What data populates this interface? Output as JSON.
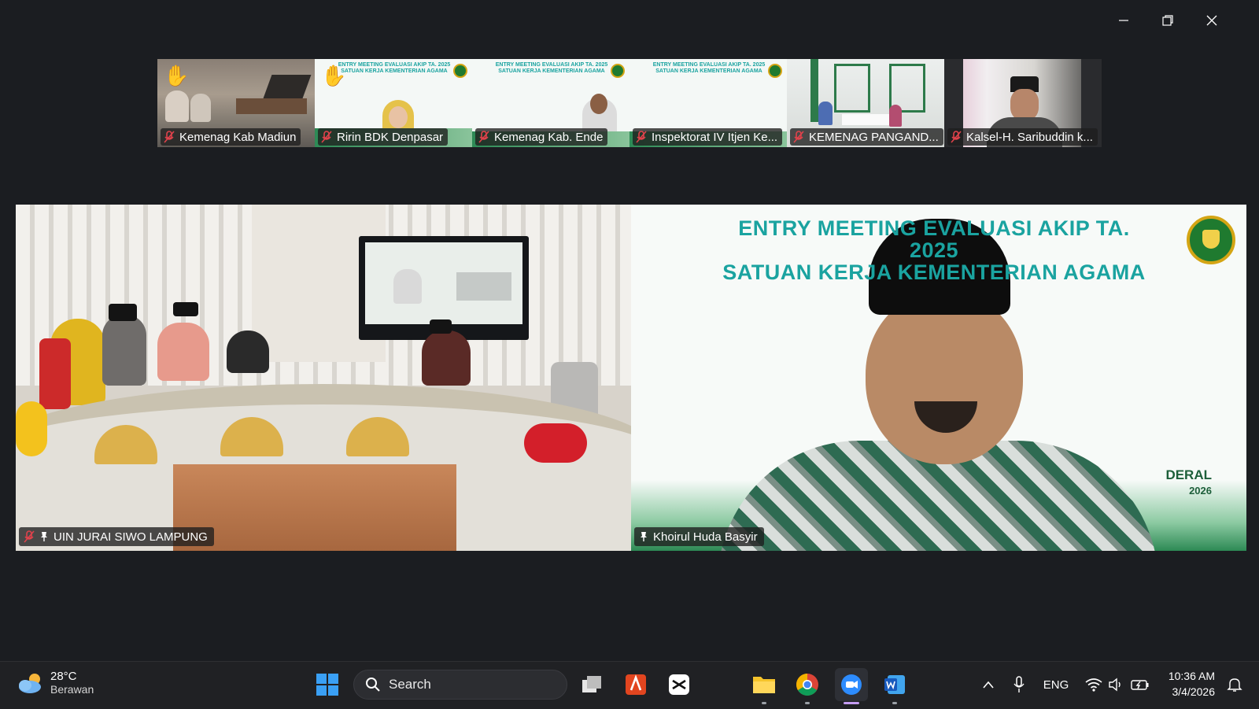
{
  "thumbnails": [
    {
      "name": "Kemenag Kab Madiun",
      "hand_raised": true,
      "banner": ""
    },
    {
      "name": "Ririn BDK Denpasar",
      "hand_raised": true,
      "banner": "ENTRY MEETING EVALUASI AKIP TA. 2025 SATUAN KERJA KEMENTERIAN AGAMA"
    },
    {
      "name": "Kemenag Kab. Ende",
      "hand_raised": false,
      "banner": "ENTRY MEETING EVALUASI AKIP TA. 2025 SATUAN KERJA KEMENTERIAN AGAMA"
    },
    {
      "name": "Inspektorat IV Itjen Ke...",
      "hand_raised": false,
      "banner": "ENTRY MEETING EVALUASI AKIP TA. 2025 SATUAN KERJA KEMENTERIAN AGAMA"
    },
    {
      "name": "KEMENAG PANGAND...",
      "hand_raised": false,
      "banner": ""
    },
    {
      "name": "Kalsel-H. Saribuddin k...",
      "hand_raised": false,
      "banner": ""
    }
  ],
  "main": {
    "left": {
      "name": "UIN JURAI SIWO LAMPUNG"
    },
    "right": {
      "name": "Khoirul Huda Basyir",
      "banner_line1": "ENTRY MEETING EVALUASI AKIP TA. 2025",
      "banner_line2": "SATUAN KERJA KEMENTERIAN AGAMA",
      "corner_text_1": "DERAL",
      "corner_text_2": "2026"
    }
  },
  "taskbar": {
    "weather_temp": "28°C",
    "weather_desc": "Berawan",
    "search_label": "Search",
    "language": "ENG",
    "time": "10:36 AM",
    "date": "3/4/2026"
  },
  "colors": {
    "background": "#1b1d21",
    "taskbar": "#202124",
    "banner_teal": "#1aa3a0",
    "emblem_green": "#1f7a2f",
    "hand_yellow": "#f5c518",
    "mic_off_red": "#e0424b"
  }
}
